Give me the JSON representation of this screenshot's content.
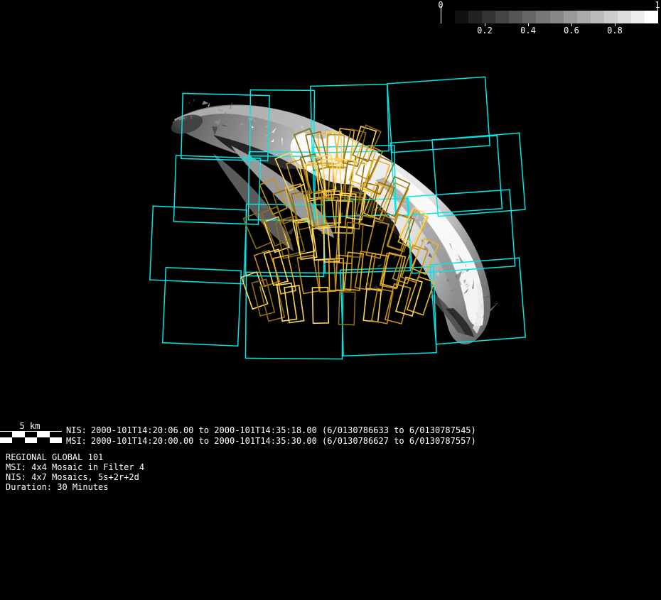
{
  "colorbar": {
    "min_label": "0",
    "max_label": "1",
    "ticks": [
      "0.2",
      "0.4",
      "0.6",
      "0.8"
    ],
    "steps": 16
  },
  "scalebar": {
    "label": "5 km"
  },
  "observations": {
    "nis": {
      "label": "NIS:",
      "text": "2000-101T14:20:06.00 to 2000-101T14:35:18.00 (6/0130786633 to 6/0130787545)"
    },
    "msi": {
      "label": "MSI:",
      "text": "2000-101T14:20:00.00 to 2000-101T14:35:30.00 (6/0130786627 to 6/0130787557)"
    }
  },
  "caption": {
    "line1": "REGIONAL GLOBAL 101",
    "line2": "MSI: 4x4 Mosaic in Filter 4",
    "line3": "NIS: 4x7 Mosaics, 5s+2r+2d",
    "line4": "Duration: 30 Minutes"
  },
  "scene": {
    "background": "#000000",
    "msi_color": "#00e8e8",
    "nis_colors": [
      "#ffd75e",
      "#e8b429",
      "#c3901a",
      "#8f6d12"
    ],
    "msi_grid": "4x4",
    "nis_grid": "4x7"
  }
}
